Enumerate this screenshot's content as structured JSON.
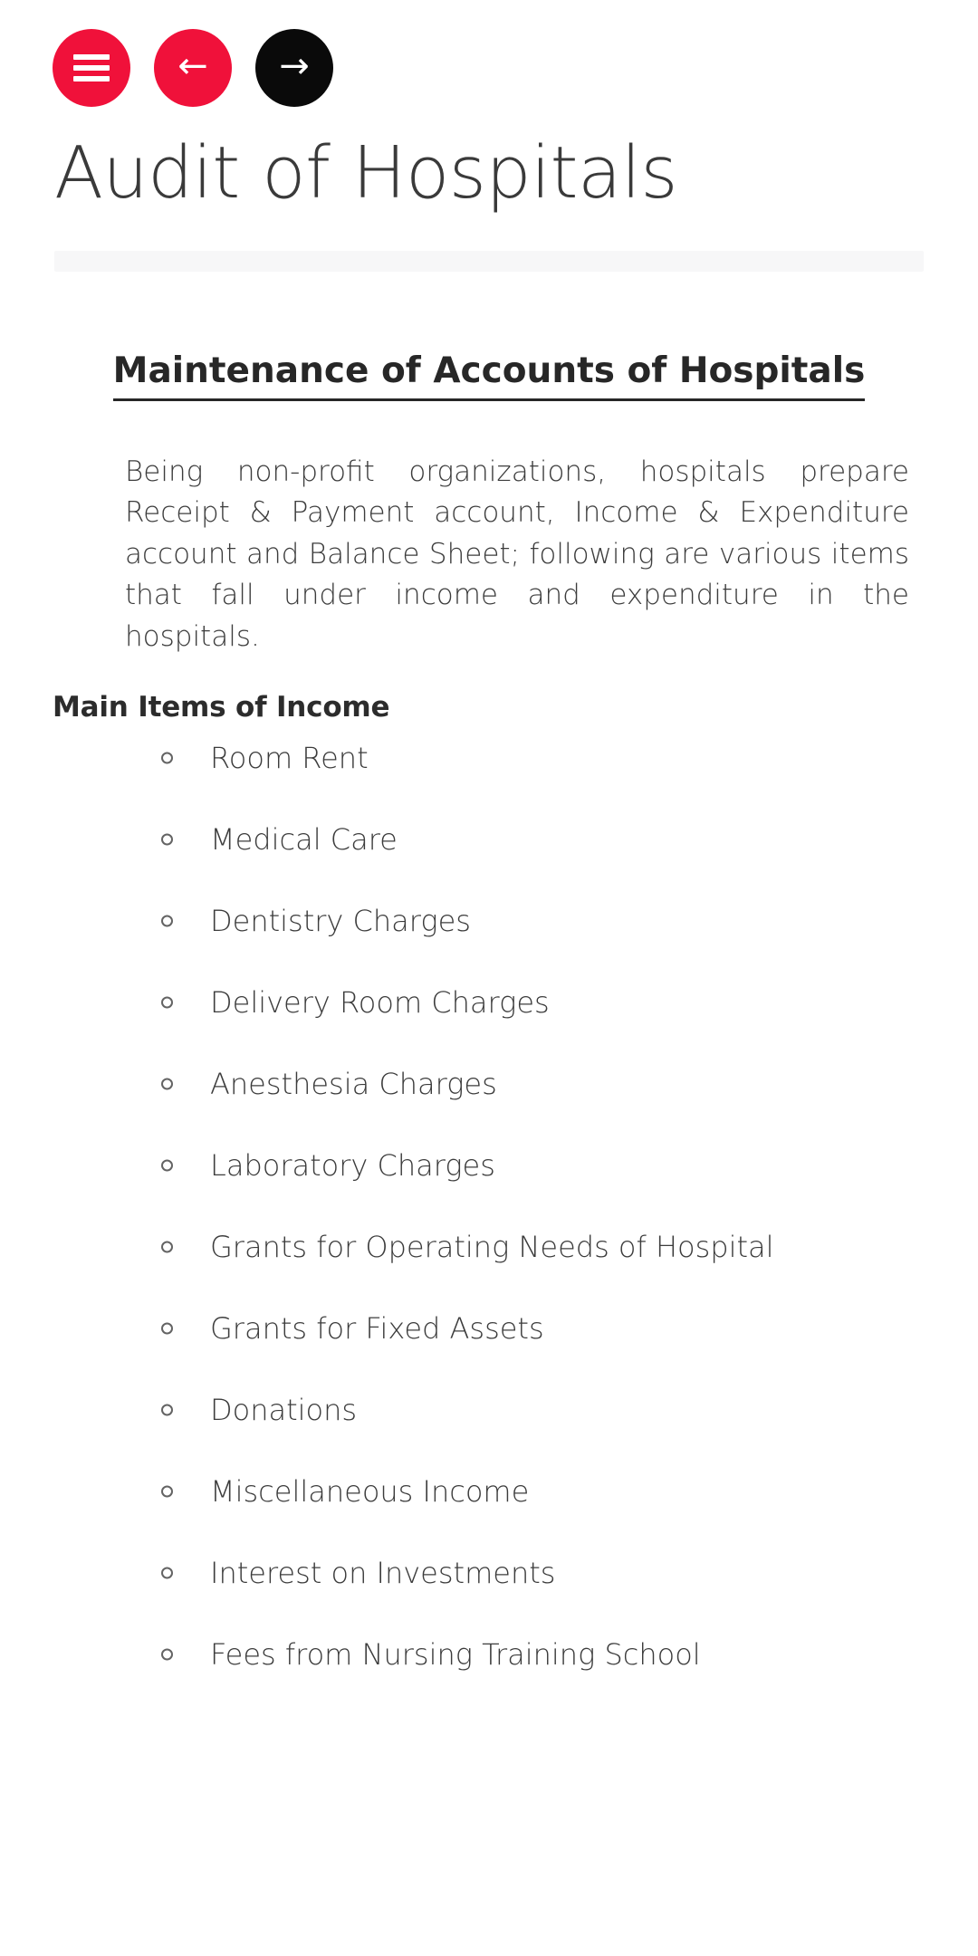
{
  "toolbar": {
    "menu_button": {
      "icon": "hamburger-icon",
      "label": "",
      "color": "#F0113A"
    },
    "back_button": {
      "icon": "arrow-left-icon",
      "label": "←",
      "color": "#F0113A"
    },
    "forward_button": {
      "icon": "arrow-right-icon",
      "label": "→",
      "color": "#0A0A0A"
    }
  },
  "document": {
    "title": "Audit of Hospitals",
    "progress": ""
  },
  "article": {
    "heading": "Maintenance of Accounts of Hospitals",
    "paragraph": "Being non-profit organizations, hospitals prepare Receipt & Payment account, Income & Expenditure account and Balance Sheet; following are various items that fall under income and expenditure in the hospitals.",
    "subheading": "Main Items of Income",
    "items": [
      "Room Rent",
      "Medical Care",
      "Dentistry Charges",
      "Delivery Room Charges",
      "Anesthesia Charges",
      "Laboratory Charges",
      "Grants for Operating Needs of Hospital",
      "Grants for Fixed Assets",
      "Donations",
      "Miscellaneous Income",
      "Interest on Investments",
      "Fees from Nursing Training School"
    ]
  }
}
